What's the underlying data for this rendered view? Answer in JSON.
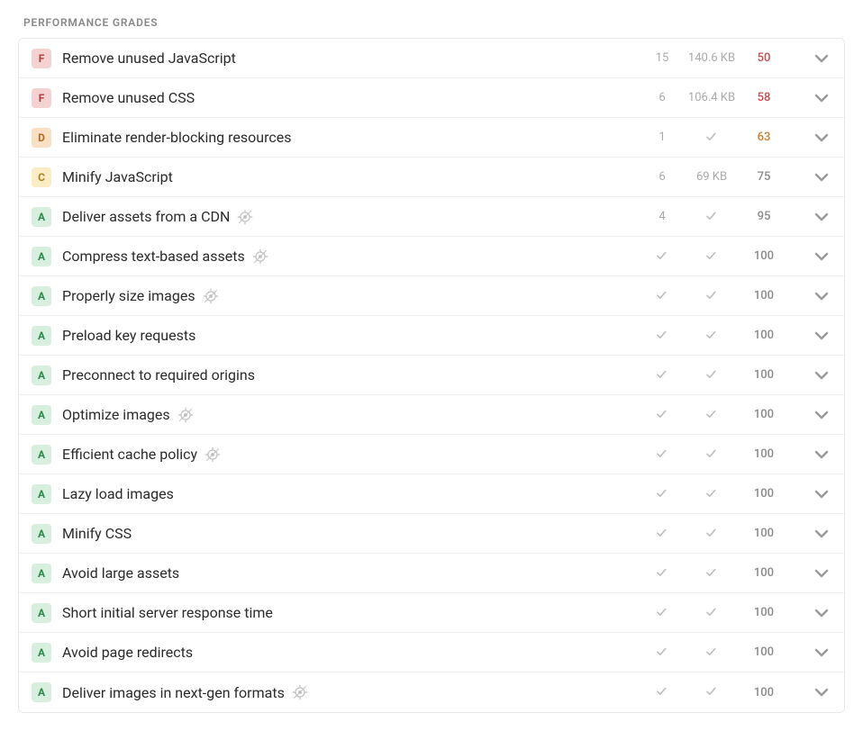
{
  "section_title": "PERFORMANCE GRADES",
  "rows": [
    {
      "grade": "F",
      "title": "Remove unused JavaScript",
      "target": false,
      "count": "15",
      "size": "140.6 KB",
      "score": "50",
      "score_class": "score-red"
    },
    {
      "grade": "F",
      "title": "Remove unused CSS",
      "target": false,
      "count": "6",
      "size": "106.4 KB",
      "score": "58",
      "score_class": "score-red"
    },
    {
      "grade": "D",
      "title": "Eliminate render-blocking resources",
      "target": false,
      "count": "1",
      "size": "check",
      "score": "63",
      "score_class": "score-orange"
    },
    {
      "grade": "C",
      "title": "Minify JavaScript",
      "target": false,
      "count": "6",
      "size": "69 KB",
      "score": "75",
      "score_class": "score-gray"
    },
    {
      "grade": "A",
      "title": "Deliver assets from a CDN",
      "target": true,
      "count": "4",
      "size": "check",
      "score": "95",
      "score_class": "score-gray"
    },
    {
      "grade": "A",
      "title": "Compress text-based assets",
      "target": true,
      "count": "check",
      "size": "check",
      "score": "100",
      "score_class": "score-gray"
    },
    {
      "grade": "A",
      "title": "Properly size images",
      "target": true,
      "count": "check",
      "size": "check",
      "score": "100",
      "score_class": "score-gray"
    },
    {
      "grade": "A",
      "title": "Preload key requests",
      "target": false,
      "count": "check",
      "size": "check",
      "score": "100",
      "score_class": "score-gray"
    },
    {
      "grade": "A",
      "title": "Preconnect to required origins",
      "target": false,
      "count": "check",
      "size": "check",
      "score": "100",
      "score_class": "score-gray"
    },
    {
      "grade": "A",
      "title": "Optimize images",
      "target": true,
      "count": "check",
      "size": "check",
      "score": "100",
      "score_class": "score-gray"
    },
    {
      "grade": "A",
      "title": "Efficient cache policy",
      "target": true,
      "count": "check",
      "size": "check",
      "score": "100",
      "score_class": "score-gray"
    },
    {
      "grade": "A",
      "title": "Lazy load images",
      "target": false,
      "count": "check",
      "size": "check",
      "score": "100",
      "score_class": "score-gray"
    },
    {
      "grade": "A",
      "title": "Minify CSS",
      "target": false,
      "count": "check",
      "size": "check",
      "score": "100",
      "score_class": "score-gray"
    },
    {
      "grade": "A",
      "title": "Avoid large assets",
      "target": false,
      "count": "check",
      "size": "check",
      "score": "100",
      "score_class": "score-gray"
    },
    {
      "grade": "A",
      "title": "Short initial server response time",
      "target": false,
      "count": "check",
      "size": "check",
      "score": "100",
      "score_class": "score-gray"
    },
    {
      "grade": "A",
      "title": "Avoid page redirects",
      "target": false,
      "count": "check",
      "size": "check",
      "score": "100",
      "score_class": "score-gray"
    },
    {
      "grade": "A",
      "title": "Deliver images in next-gen formats",
      "target": true,
      "count": "check",
      "size": "check",
      "score": "100",
      "score_class": "score-gray"
    }
  ]
}
